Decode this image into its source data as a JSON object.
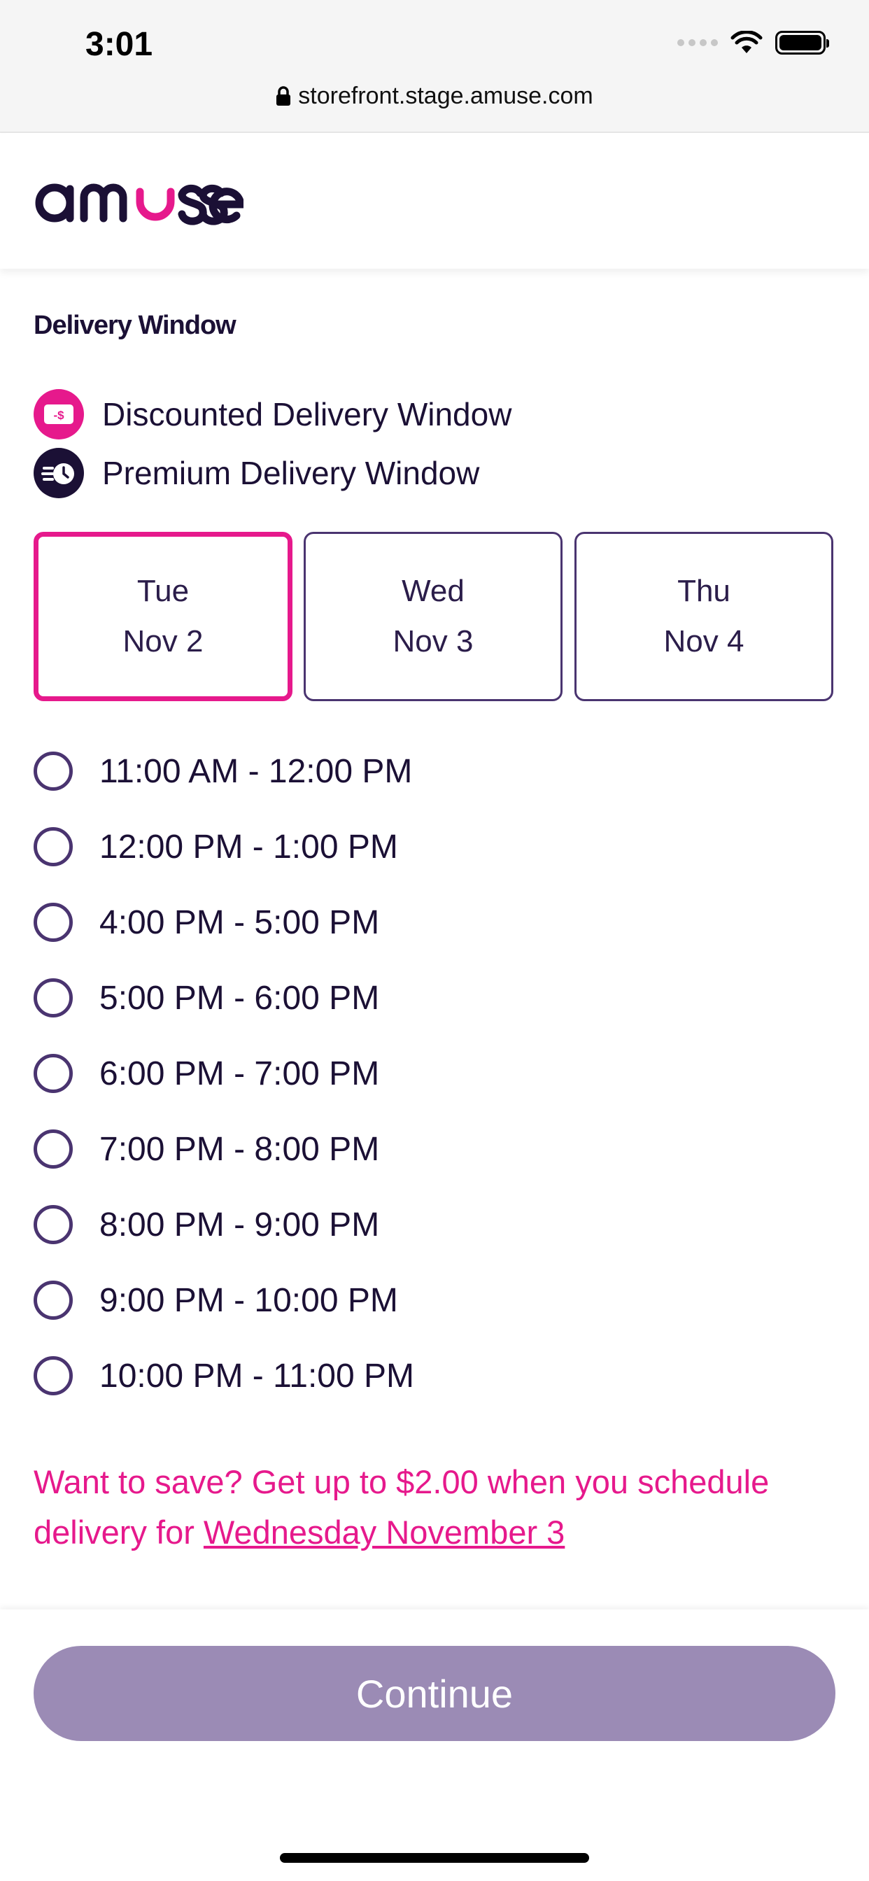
{
  "status_bar": {
    "time": "3:01"
  },
  "browser": {
    "url": "storefront.stage.amuse.com"
  },
  "header": {
    "logo_text": "amuse"
  },
  "section": {
    "title": "Delivery Window"
  },
  "legend": {
    "discounted": {
      "label": "Discounted Delivery Window",
      "icon": "discount-tag-icon",
      "icon_text": "-$",
      "color": "#e6198c"
    },
    "premium": {
      "label": "Premium Delivery Window",
      "icon": "fast-clock-icon",
      "color": "#1b1035"
    }
  },
  "days": [
    {
      "weekday": "Tue",
      "date": "Nov 2",
      "selected": true
    },
    {
      "weekday": "Wed",
      "date": "Nov 3",
      "selected": false
    },
    {
      "weekday": "Thu",
      "date": "Nov 4",
      "selected": false
    }
  ],
  "time_slots": [
    "11:00 AM - 12:00 PM",
    "12:00 PM - 1:00 PM",
    "4:00 PM - 5:00 PM",
    "5:00 PM - 6:00 PM",
    "6:00 PM - 7:00 PM",
    "7:00 PM - 8:00 PM",
    "8:00 PM - 9:00 PM",
    "9:00 PM - 10:00 PM",
    "10:00 PM - 11:00 PM"
  ],
  "promo": {
    "text": "Want to save? Get up to $2.00 when you schedule delivery for ",
    "link": "Wednesday November 3"
  },
  "footer": {
    "continue_label": "Continue"
  },
  "colors": {
    "accent": "#e6198c",
    "brand_dark": "#1b1035",
    "border_purple": "#4a3470",
    "button_disabled": "#9b8bb5"
  }
}
